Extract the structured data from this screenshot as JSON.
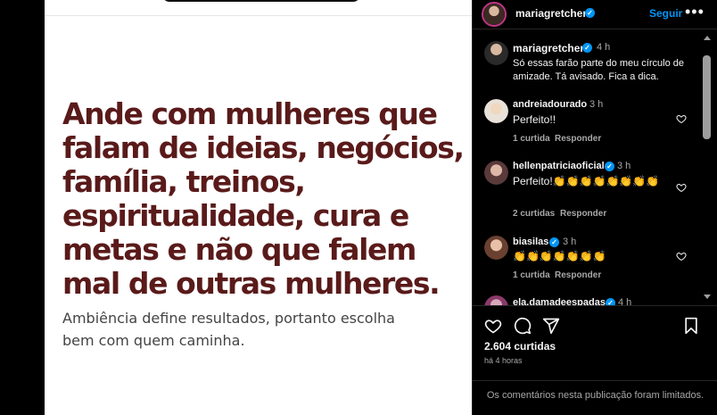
{
  "image_card": {
    "quote": "Ande com mulheres que falam de ideias, negócios, família, treinos, espiritualidade, cura e metas e não que falem mal de outras mulheres.",
    "subtext": "Ambiência define resultados,  portanto escolha bem com quem caminha."
  },
  "header": {
    "username": "mariagretchen",
    "follow_label": "Seguir",
    "more_label": "•••"
  },
  "caption": {
    "username": "mariagretchen",
    "time": "4 h",
    "text": "Só essas farão parte do meu círculo de amizade. Tá avisado. Fica a dica."
  },
  "comments": [
    {
      "username": "andreiadourado",
      "time": "3 h",
      "text": "Perfeito!!",
      "likes": "1 curtida",
      "reply": "Responder",
      "verified": false
    },
    {
      "username": "hellenpatriciaoficial",
      "time": "3 h",
      "text": "Perfeito!👏👏👏👏👏👏👏👏",
      "likes": "2 curtidas",
      "reply": "Responder",
      "verified": true
    },
    {
      "username": "biasilas",
      "time": "3 h",
      "text": "👏👏👏👏👏👏👏",
      "likes": "1 curtida",
      "reply": "Responder",
      "verified": true
    },
    {
      "username": "ela.damadeespadas",
      "time": "4 h",
      "text": "",
      "likes": "",
      "reply": "",
      "verified": true
    }
  ],
  "actions": {
    "likes": "2.604 curtidas",
    "time": "há 4 horas",
    "limited_notice": "Os comentários nesta publicação foram limitados."
  },
  "colors": {
    "accent": "#0095f6",
    "quote": "#5a1a1a",
    "background": "#000000"
  }
}
